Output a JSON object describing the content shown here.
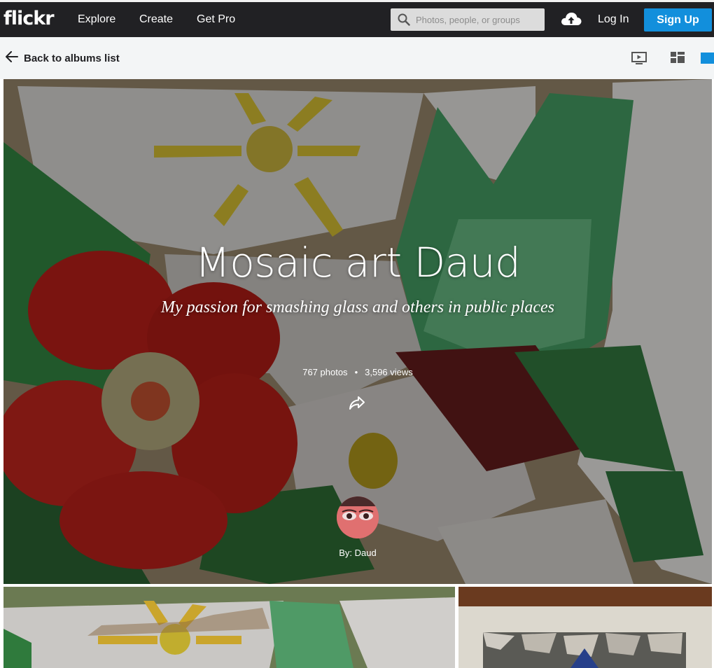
{
  "nav": {
    "logo": "flickr",
    "links": [
      "Explore",
      "Create",
      "Get Pro"
    ],
    "search_placeholder": "Photos, people, or groups",
    "login": "Log In",
    "signup": "Sign Up"
  },
  "subbar": {
    "back_label": "Back to albums list"
  },
  "album": {
    "title": "Mosaic art Daud",
    "description": "My passion for smashing glass and others in public places",
    "photos": "767 photos",
    "views": "3,596 views",
    "separator": "•",
    "by": "By: Daud"
  },
  "colors": {
    "nav_bg": "#212124",
    "signup_bg": "#128fdc",
    "accent_square": "#128fdc"
  },
  "icons": [
    "search-icon",
    "upload-cloud-icon",
    "back-arrow-icon",
    "slideshow-icon",
    "grid-view-icon",
    "list-view-icon",
    "share-icon"
  ]
}
